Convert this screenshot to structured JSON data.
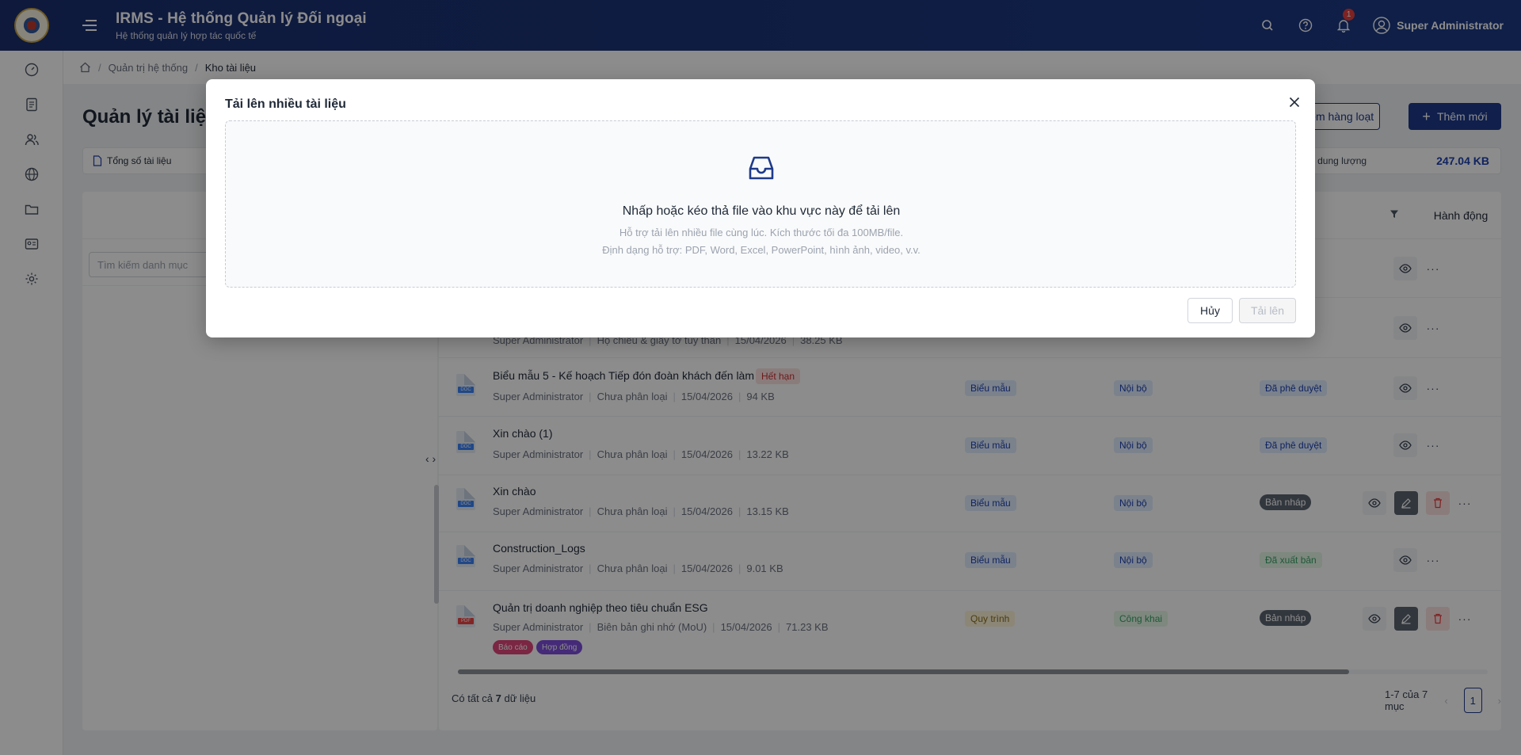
{
  "app": {
    "title": "IRMS - Hệ thống Quản lý Đối ngoại",
    "subtitle": "Hệ thống quản lý hợp tác quốc tế",
    "notification_count": "1",
    "user_name": "Super Administrator"
  },
  "breadcrumb": {
    "items": [
      "Quản trị hệ thống",
      "Kho tài liệu"
    ]
  },
  "page": {
    "title": "Quản lý tài liệu",
    "batch_add_label": "Thêm hàng loạt",
    "add_new_label": "Thêm mới",
    "stat_total_label": "Tổng số tài liệu",
    "stat_size_label": "g dung lượng",
    "stat_size_value": "247.04 KB",
    "category_search_placeholder": "Tìm kiếm danh mục",
    "actions_header": "Hành động"
  },
  "documents": [
    {
      "title": "",
      "author": "",
      "category": "",
      "date": "",
      "size": "",
      "type": "",
      "scope": "",
      "status": ""
    },
    {
      "title": "",
      "author": "Super Administrator",
      "category": "Hộ chiếu & giấy tờ tùy thân",
      "date": "15/04/2026",
      "size": "38.25 KB",
      "type": "",
      "scope": "",
      "status": ""
    },
    {
      "title": "Biểu mẫu 5 - Kế hoạch Tiếp đón đoàn khách đến làm việc",
      "author": "Super Administrator",
      "category": "Chưa phân loại",
      "date": "15/04/2026",
      "size": "94 KB",
      "expired": "Hết hạn",
      "type": "Biểu mẫu",
      "scope": "Nội bộ",
      "status": "Đã phê duyệt"
    },
    {
      "title": "Xin chào (1)",
      "author": "Super Administrator",
      "category": "Chưa phân loại",
      "date": "15/04/2026",
      "size": "13.22 KB",
      "type": "Biểu mẫu",
      "scope": "Nội bộ",
      "status": "Đã phê duyệt"
    },
    {
      "title": "Xin chào",
      "author": "Super Administrator",
      "category": "Chưa phân loại",
      "date": "15/04/2026",
      "size": "13.15 KB",
      "type": "Biểu mẫu",
      "scope": "Nội bộ",
      "status": "Bản nháp"
    },
    {
      "title": "Construction_Logs",
      "author": "Super Administrator",
      "category": "Chưa phân loại",
      "date": "15/04/2026",
      "size": "9.01 KB",
      "type": "Biểu mẫu",
      "scope": "Nội bộ",
      "status": "Đã xuất bản"
    },
    {
      "title": "Quản trị doanh nghiệp theo tiêu chuẩn ESG",
      "author": "Super Administrator",
      "category": "Biên bản ghi nhớ (MoU)",
      "date": "15/04/2026",
      "size": "71.23 KB",
      "type": "Quy trình",
      "scope": "Công khai",
      "status": "Bản nháp",
      "tags": [
        "Báo cáo",
        "Hợp đồng"
      ]
    }
  ],
  "file_ext": {
    "doc": "DOC",
    "pdf": "PDF"
  },
  "footer": {
    "total_prefix": "Có tất cả ",
    "total_count": "7",
    "total_suffix": " dữ liệu",
    "range": "1-7 của 7 mục",
    "page": "1"
  },
  "modal": {
    "title": "Tải lên nhiều tài liệu",
    "drop_main": "Nhấp hoặc kéo thả file vào khu vực này để tải lên",
    "drop_sub1": "Hỗ trợ tải lên nhiều file cùng lúc. Kích thước tối đa 100MB/file.",
    "drop_sub2": "Định dạng hỗ trợ: PDF, Word, Excel, PowerPoint, hình ảnh, video, v.v.",
    "cancel_label": "Hủy",
    "upload_label": "Tải lên"
  },
  "colors": {
    "header_bg": "#1d3a84",
    "primary": "#1e3a8a",
    "danger": "#e53e3e"
  },
  "icons": {
    "header": [
      "search-icon",
      "help-icon",
      "bell-icon",
      "user-icon"
    ],
    "sidebar": [
      "dashboard-icon",
      "document-icon",
      "users-icon",
      "globe-icon",
      "folder-icon",
      "id-card-icon",
      "settings-icon"
    ]
  }
}
